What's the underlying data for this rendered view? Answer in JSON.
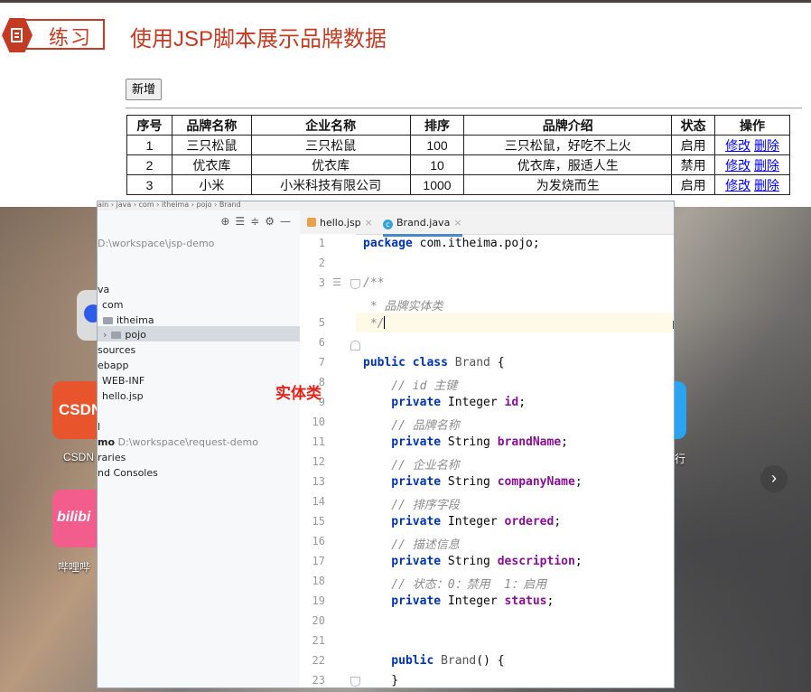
{
  "slide": {
    "badge_label": "练习",
    "title": "使用JSP脚本展示品牌数据",
    "new_button": "新增",
    "table": {
      "headers": [
        "序号",
        "品牌名称",
        "企业名称",
        "排序",
        "品牌介绍",
        "状态",
        "操作"
      ],
      "rows": [
        {
          "id": "1",
          "brand": "三只松鼠",
          "company": "三只松鼠",
          "ordered": "100",
          "description": "三只松鼠，好吃不上火",
          "status": "启用",
          "edit": "修改",
          "delete": "删除"
        },
        {
          "id": "2",
          "brand": "优衣库",
          "company": "优衣库",
          "ordered": "10",
          "description": "优衣库，服适人生",
          "status": "禁用",
          "edit": "修改",
          "delete": "删除"
        },
        {
          "id": "3",
          "brand": "小米",
          "company": "小米科技有限公司",
          "ordered": "1000",
          "description": "为发烧而生",
          "status": "启用",
          "edit": "修改",
          "delete": "删除"
        }
      ]
    }
  },
  "desktop": {
    "icons": [
      {
        "label": "CSDN",
        "tile_text": "CSDN",
        "color": "#e8542c"
      },
      {
        "label": "哔哩哔",
        "tile_text": "bilibi",
        "color": "#f25d8e"
      }
    ],
    "right_label": "行",
    "nav_arrow": "›"
  },
  "ide": {
    "breadcrumb": "ain › java › com › itheima › pojo › Brand",
    "project_tree": [
      {
        "text": "D:\\workspace\\jsp-demo",
        "muted": true
      },
      {
        "text": "va"
      },
      {
        "text": "com"
      },
      {
        "text": "itheima"
      },
      {
        "text": "pojo"
      },
      {
        "text": "sources"
      },
      {
        "text": "ebapp"
      },
      {
        "text": "WEB-INF"
      },
      {
        "text": "hello.jsp"
      },
      {
        "text": "l"
      },
      {
        "text": "mo",
        "suffix": "D:\\workspace\\request-demo"
      },
      {
        "text": "raries"
      },
      {
        "text": "nd Consoles"
      }
    ],
    "tabs": [
      {
        "label": "hello.jsp",
        "close": "×"
      },
      {
        "label": "Brand.java",
        "close": "×"
      }
    ],
    "line_numbers": [
      "1",
      "2",
      "3",
      "5",
      "6",
      "7",
      "8",
      "9",
      "10",
      "11",
      "12",
      "13",
      "14",
      "15",
      "16",
      "17",
      "18",
      "19",
      "20",
      "21",
      "22",
      "23"
    ],
    "code": {
      "l1_kw": "package",
      "l1_rest": " com.itheima.pojo;",
      "l3": "/**",
      "l4": " * 品牌实体类",
      "l5": " */",
      "l7_kw1": "public class",
      "l7_name": " Brand",
      "l7_rest": " {",
      "l8": "    // id 主键",
      "l9_kw": "    private",
      "l9_type": " Integer ",
      "l9_field": "id",
      "l9_end": ";",
      "l10": "    // 品牌名称",
      "l11_kw": "    private",
      "l11_type": " String ",
      "l11_field": "brandName",
      "l11_end": ";",
      "l12": "    // 企业名称",
      "l13_kw": "    private",
      "l13_type": " String ",
      "l13_field": "companyName",
      "l13_end": ";",
      "l14": "    // 排序字段",
      "l15_kw": "    private",
      "l15_type": " Integer ",
      "l15_field": "ordered",
      "l15_end": ";",
      "l16": "    // 描述信息",
      "l17_kw": "    private",
      "l17_type": " String ",
      "l17_field": "description",
      "l17_end": ";",
      "l18": "    // 状态：0：禁用  1：启用",
      "l19_kw": "    private",
      "l19_type": " Integer ",
      "l19_field": "status",
      "l19_end": ";",
      "l22_kw": "    public",
      "l22_name": " Brand",
      "l22_rest": "() {",
      "l23": "    }"
    }
  },
  "annotation": "实体类"
}
